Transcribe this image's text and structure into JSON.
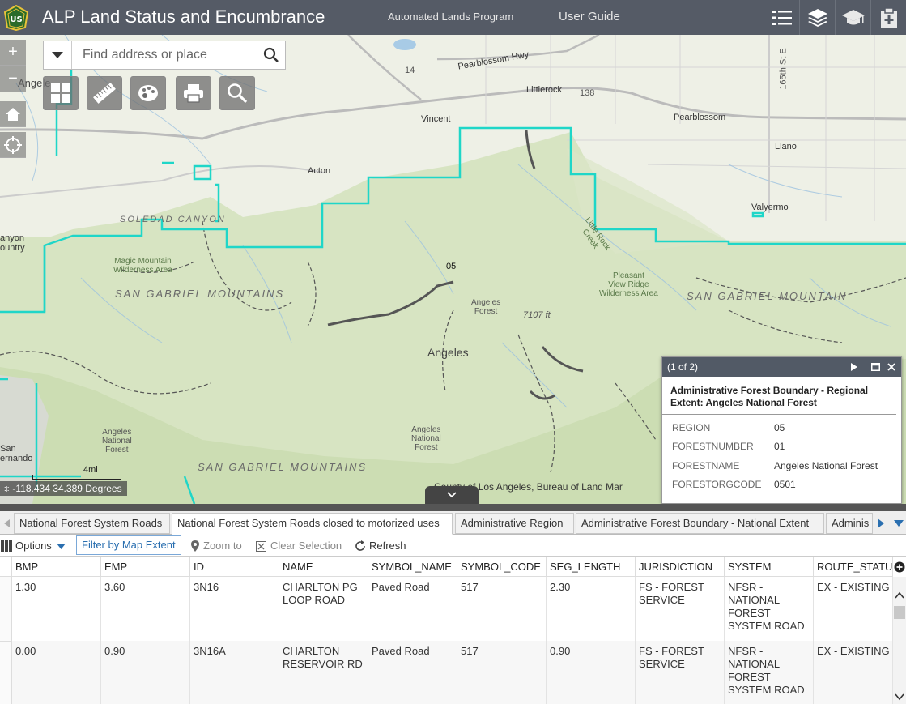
{
  "header": {
    "title": "ALP Land Status and Encumbrance",
    "logo_text": "US",
    "links": [
      "Automated Lands Program",
      "User Guide"
    ]
  },
  "search": {
    "placeholder": "Find address or place"
  },
  "map": {
    "labels": {
      "pearblossom_hwy": "Pearblossom Hwy",
      "littlerock": "Littlerock",
      "route138": "138",
      "vincent": "Vincent",
      "pearblossom": "Pearblossom",
      "llano": "Llano",
      "acton": "Acton",
      "valyermo": "Valyermo",
      "soledad_canyon": "SOLEDAD CANYON",
      "canyon_country": "anyon\nountry",
      "magic_mountain": "Magic Mountain\nWilderness Area",
      "san_gabriel_1": "SAN GABRIEL MOUNTAINS",
      "san_gabriel_2": "SAN GABRIEL MOUNTAIN",
      "san_gabriel_3": "SAN GABRIEL MOUNTAINS",
      "pleasant_view": "Pleasant\nView Ridge\nWilderness Area",
      "label_05": "05",
      "angeles_forest": "Angeles\nForest",
      "elev": "7107 ft",
      "angeles": "Angeles",
      "angeles_nf_1": "Angeles\nNational\nForest",
      "angeles_nf_2": "Angeles\nNational\nForest",
      "angeles_top": "Angele",
      "san_fernando": "San\nernando",
      "route14": "14",
      "east_st": "165th St E",
      "lw_rock": "Little Rock\nCreek"
    },
    "scale": "4mi",
    "coordinates": "-118.434 34.389 Degrees",
    "attribution": "County of Los Angeles, Bureau of Land Mar"
  },
  "popup": {
    "counter": "(1 of 2)",
    "title": "Administrative Forest Boundary - Regional Extent: Angeles National Forest",
    "fields": [
      {
        "key": "REGION",
        "value": "05"
      },
      {
        "key": "FORESTNUMBER",
        "value": "01"
      },
      {
        "key": "FORESTNAME",
        "value": "Angeles National Forest"
      },
      {
        "key": "FORESTORGCODE",
        "value": "0501"
      }
    ]
  },
  "tabs": [
    "National Forest System Roads",
    "National Forest System Roads closed to motorized uses",
    "Administrative Region",
    "Administrative Forest Boundary - National Extent",
    "Adminis"
  ],
  "toolbar": {
    "options": "Options",
    "filter": "Filter by Map Extent",
    "zoom_to": "Zoom to",
    "clear": "Clear Selection",
    "refresh": "Refresh"
  },
  "table": {
    "columns": [
      "BMP",
      "EMP",
      "ID",
      "NAME",
      "SYMBOL_NAME",
      "SYMBOL_CODE",
      "SEG_LENGTH",
      "JURISDICTION",
      "SYSTEM",
      "ROUTE_STATU"
    ],
    "rows": [
      [
        "1.30",
        "3.60",
        "3N16",
        "CHARLTON PG LOOP ROAD",
        "Paved Road",
        "517",
        "2.30",
        "FS - FOREST SERVICE",
        "NFSR - NATIONAL FOREST SYSTEM ROAD",
        "EX - EXISTING"
      ],
      [
        "0.00",
        "0.90",
        "3N16A",
        "CHARLTON RESERVOIR RD",
        "Paved Road",
        "517",
        "0.90",
        "FS - FOREST SERVICE",
        "NFSR - NATIONAL FOREST SYSTEM ROAD",
        "EX - EXISTING"
      ]
    ]
  },
  "colors": {
    "header_bg": "#555b66",
    "boundary": "#1fd6c8",
    "map_bg": "#eef0e6",
    "forest": "#cfe0b5"
  }
}
